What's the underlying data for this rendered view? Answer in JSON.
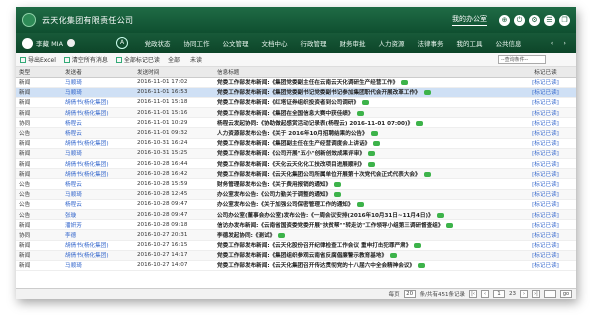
{
  "app": {
    "title": "云天化集团有限责任公司",
    "office": "我的办公室"
  },
  "top_icons": [
    "⊕",
    "⏻",
    "⚙",
    "☰",
    "❐"
  ],
  "user": {
    "name": "李藏 MIA"
  },
  "nav": {
    "home": "A",
    "items": [
      "党政状态",
      "协同工作",
      "公文管理",
      "文档中心",
      "行政管理",
      "财务审批",
      "人力资源",
      "法律事务",
      "我的工具",
      "公共信息"
    ],
    "arrows": "‹ ›"
  },
  "toolbar": {
    "export": "导出Excel",
    "clear": "清空所有消息",
    "mark_read": "全部标记已读",
    "filter_all": "全部",
    "filter_unread": "未读",
    "search_placeholder": "--查询条件--"
  },
  "table": {
    "headers": [
      "类型",
      "发送者",
      "发送时间",
      "信息标题",
      "标记已读"
    ],
    "rows": [
      {
        "type": "新闻",
        "sender": "马顺琦",
        "time": "2016-11-01 17:02",
        "title": "党委工作部发布新闻:《集团党委副主任在云南云天化调研生产经营工作》",
        "status": "[标记已读]"
      },
      {
        "type": "新闻",
        "sender": "马顺琦",
        "time": "2016-11-01 16:53",
        "title": "党委工作部发布新闻:《集团党委副书记党委副书记参加集团职代会开展改革工作》",
        "status": "[标记已读]"
      },
      {
        "type": "新闻",
        "sender": "胡倩书(杨化集团)",
        "time": "2016-11-01 15:18",
        "title": "党委工作部发布新闻:《红塔证券组织投资者到公司调研》",
        "status": "[标记已读]"
      },
      {
        "type": "新闻",
        "sender": "胡倩书(杨化集团)",
        "time": "2016-11-01 15:16",
        "title": "党委工作部发布新闻:《集团在全国信息大赛中获佳绩》",
        "status": "[标记已读]"
      },
      {
        "type": "协同",
        "sender": "杨程云",
        "time": "2016-11-01 10:29",
        "title": "杨程云发起协同:《协助做起感赏活动记录表(杨程云) 2016-11-01 07:00)》",
        "status": "[标记已读]"
      },
      {
        "type": "公告",
        "sender": "杨程云",
        "time": "2016-11-01 09:32",
        "title": "人力资源部发布公告:《关于 2016年10月招聘结果的公告》",
        "status": "[标记已读]"
      },
      {
        "type": "新闻",
        "sender": "胡倩书(杨化集团)",
        "time": "2016-10-31 16:24",
        "title": "党委工作部发布新闻:《集团副主任在生产经营调度会上讲话》",
        "status": "[标记已读]"
      },
      {
        "type": "新闻",
        "sender": "马顺琦",
        "time": "2016-10-31 15:25",
        "title": "党委工作部发布新闻:《公司开展\"五小\"创新创效成果评审》",
        "status": "[标记已读]"
      },
      {
        "type": "新闻",
        "sender": "胡倩书(杨化集团)",
        "time": "2016-10-28 16:44",
        "title": "党委工作部发布新闻:《天化云天化化工技改项目进展顺利》",
        "status": "[标记已读]"
      },
      {
        "type": "新闻",
        "sender": "胡倩书(杨化集团)",
        "time": "2016-10-28 16:42",
        "title": "党委工作部发布新闻:《云天化集团公司所属单位开展第十次党代会正式代表大会》",
        "status": "[标记已读]"
      },
      {
        "type": "公告",
        "sender": "杨程云",
        "time": "2016-10-28 15:59",
        "title": "财务管理部发布公告:《关于费用报销的通知》",
        "status": "[标记已读]"
      },
      {
        "type": "公告",
        "sender": "马顺琦",
        "time": "2016-10-28 12:45",
        "title": "办公室发布公告:《公司力勤关于调整的通知》",
        "status": "[标记已读]"
      },
      {
        "type": "公告",
        "sender": "杨程云",
        "time": "2016-10-28 09:47",
        "title": "办公室发布公告:《关于加强公司保密管理工作的通知》",
        "status": "[标记已读]"
      },
      {
        "type": "公告",
        "sender": "张璇",
        "time": "2016-10-28 09:47",
        "title": "公司办公室(董事会办公室)发布公告:《一周会议安排(2016年10月31日~11月4日)》",
        "status": "[标记已读]"
      },
      {
        "type": "新闻",
        "sender": "潘妍芳",
        "time": "2016-10-28 09:18",
        "title": "信访办发布新闻:《云南省国资委党委开展\"扶贫帮\"\"转走访\"工作领导小组第三调研督查组》",
        "status": "[标记已读]"
      },
      {
        "type": "协同",
        "sender": "李德",
        "time": "2016-10-27 20:31",
        "title": "李德发起协同:《测试》",
        "status": "[标记已读]"
      },
      {
        "type": "新闻",
        "sender": "胡倩书(杨化集团)",
        "time": "2016-10-27 16:15",
        "title": "党委工作部发布新闻:《云天化股份召开纪律检查工作会议 重申打击犯罪严肃》",
        "status": "[标记已读]"
      },
      {
        "type": "新闻",
        "sender": "胡倩书(杨化集团)",
        "time": "2016-10-27 14:17",
        "title": "党委工作部发布新闻:《集团组织参观云南省反腐倡廉警示教育基地》",
        "status": "[标记已读]"
      },
      {
        "type": "新闻",
        "sender": "马顺琦",
        "time": "2016-10-27 14:07",
        "title": "党委工作部发布新闻:《云天化集团召开传达贯彻党的十八届六中全会精神会议》",
        "status": "[标记已读]"
      }
    ]
  },
  "pager": {
    "per_page_label": "每页",
    "per_page": "20",
    "summary": "条/共有451条记录",
    "page": "1",
    "total_pages": "23",
    "go": "go"
  }
}
